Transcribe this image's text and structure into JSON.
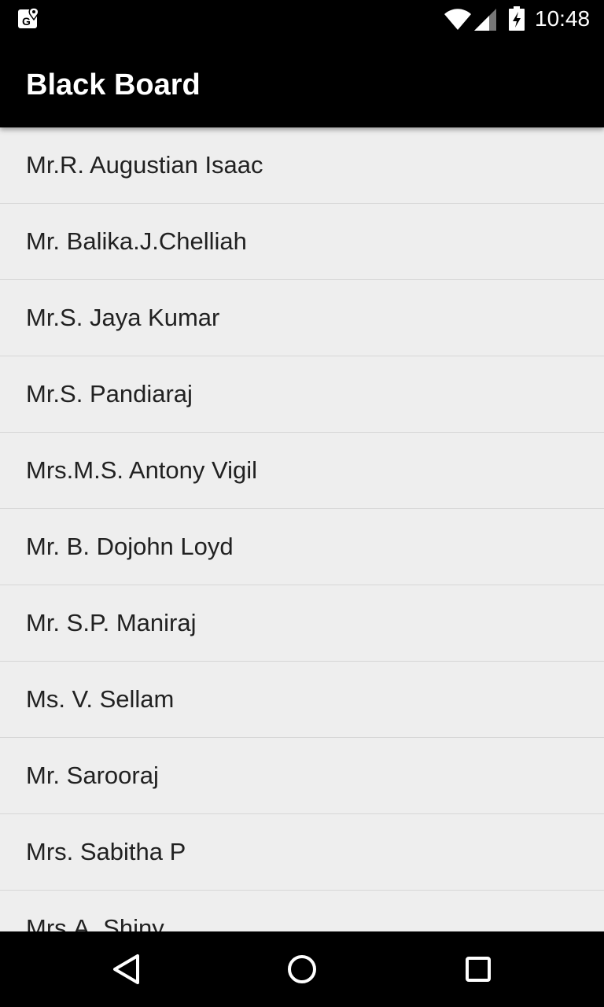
{
  "status_bar": {
    "time": "10:48",
    "icons": [
      "maps-notification-icon",
      "wifi-icon",
      "signal-icon",
      "battery-charging-icon"
    ]
  },
  "app_bar": {
    "title": "Black Board"
  },
  "teachers": [
    "Mr.R. Augustian Isaac",
    "Mr. Balika.J.Chelliah",
    "Mr.S. Jaya Kumar",
    "Mr.S. Pandiaraj",
    "Mrs.M.S. Antony Vigil",
    "Mr. B. Dojohn Loyd",
    "Mr. S.P. Maniraj",
    "Ms. V. Sellam",
    "Mr. Sarooraj",
    "Mrs. Sabitha P",
    "Mrs.A. Shiny"
  ],
  "nav_bar": {
    "icons": [
      "back-icon",
      "home-icon",
      "recents-icon"
    ]
  },
  "colors": {
    "bar_background": "#000000",
    "list_background": "#eeeeee",
    "divider": "#d6d6d6",
    "text": "#212121"
  }
}
